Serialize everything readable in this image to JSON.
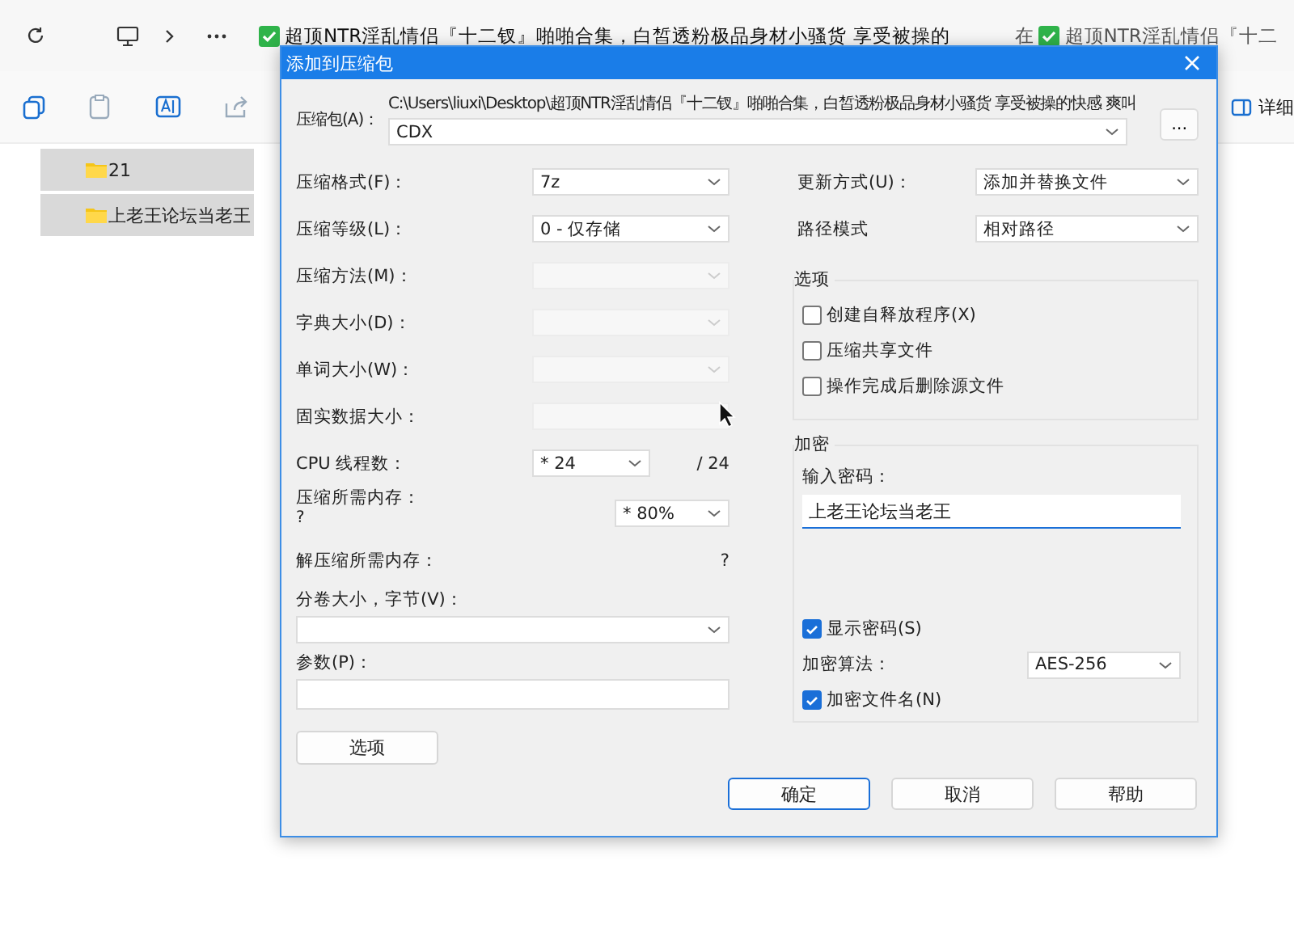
{
  "explorer": {
    "breadcrumb_folder": "超顶NTR淫乱情侣『十二钗』啪啪合集，白皙透粉极品身材小骚货 享受被操的",
    "search_prefix": "在",
    "search_folder": "超顶NTR淫乱情侣『十二",
    "details_button": "详细",
    "folders": [
      {
        "name": "21",
        "selected": true
      },
      {
        "name": "上老王论坛当老王",
        "selected": true
      }
    ]
  },
  "dialog": {
    "title": "添加到压缩包",
    "archive_label": "压缩包(A)：",
    "archive_path": "C:\\Users\\liuxi\\Desktop\\超顶NTR淫乱情侣『十二钗』啪啪合集，白皙透粉极品身材小骚货 享受被操的快感 爽叫",
    "archive_name": "CDX",
    "browse_button": "...",
    "left_rows": [
      {
        "kind": "select",
        "label": "压缩格式(F)：",
        "value": "7z",
        "disabled": false
      },
      {
        "kind": "select",
        "label": "压缩等级(L)：",
        "value": "0 - 仅存储",
        "disabled": false
      },
      {
        "kind": "select",
        "label": "压缩方法(M)：",
        "disabled": true
      },
      {
        "kind": "select",
        "label": "字典大小(D)：",
        "disabled": true
      },
      {
        "kind": "select",
        "label": "单词大小(W)：",
        "disabled": true
      },
      {
        "kind": "input",
        "label": "固实数据大小：",
        "disabled": true
      }
    ],
    "cpu": {
      "label": "CPU 线程数：",
      "value": "* 24",
      "max": "/ 24"
    },
    "memory": {
      "label": "压缩所需内存：",
      "note": "?",
      "value": "* 80%"
    },
    "decompress_memory": {
      "label": "解压缩所需内存：",
      "value": "?"
    },
    "volume": {
      "label": "分卷大小，字节(V)："
    },
    "parameters": {
      "label": "参数(P)："
    },
    "options_button": "选项",
    "update": {
      "label": "更新方式(U)：",
      "value": "添加并替换文件"
    },
    "path_mode": {
      "label": "路径模式",
      "value": "相对路径"
    },
    "options_group": {
      "title": "选项",
      "checkboxes": [
        {
          "label": "创建自释放程序(X)",
          "checked": false
        },
        {
          "label": "压缩共享文件",
          "checked": false
        },
        {
          "label": "操作完成后删除源文件",
          "checked": false
        }
      ]
    },
    "encryption": {
      "title": "加密",
      "password_label": "输入密码：",
      "password": "上老王论坛当老王",
      "show_password": {
        "label": "显示密码(S)",
        "checked": true
      },
      "algorithm_label": "加密算法：",
      "algorithm": "AES-256",
      "encrypt_names": {
        "label": "加密文件名(N)",
        "checked": true
      }
    },
    "buttons": [
      {
        "label": "确定",
        "default": true
      },
      {
        "label": "取消",
        "default": false
      },
      {
        "label": "帮助",
        "default": false
      }
    ]
  }
}
